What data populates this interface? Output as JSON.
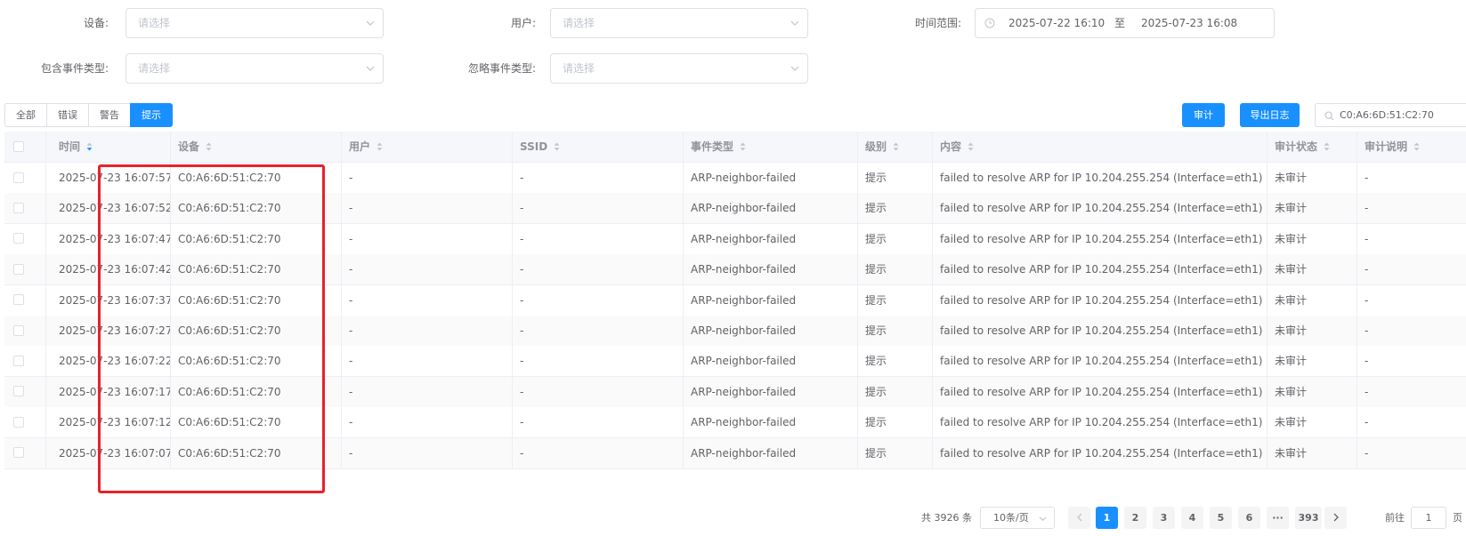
{
  "filters": {
    "device_label": "设备:",
    "device_placeholder": "请选择",
    "user_label": "用户:",
    "user_placeholder": "请选择",
    "time_label": "时间范围:",
    "time_start": "2025-07-22 16:10",
    "time_sep": "至",
    "time_end": "2025-07-23 16:08",
    "include_label": "包含事件类型:",
    "include_placeholder": "请选择",
    "ignore_label": "忽略事件类型:",
    "ignore_placeholder": "请选择"
  },
  "level_tabs": [
    {
      "label": "全部",
      "active": false
    },
    {
      "label": "错误",
      "active": false
    },
    {
      "label": "警告",
      "active": false
    },
    {
      "label": "提示",
      "active": true
    }
  ],
  "toolbar": {
    "audit_label": "审计",
    "export_label": "导出日志",
    "search_value": "C0:A6:6D:51:C2:70"
  },
  "table": {
    "columns": [
      "时间",
      "设备",
      "用户",
      "SSID",
      "事件类型",
      "级别",
      "内容",
      "审计状态",
      "审计说明"
    ],
    "rows": [
      [
        "2025-07-23 16:07:57",
        "C0:A6:6D:51:C2:70",
        "-",
        "-",
        "ARP-neighbor-failed",
        "提示",
        "failed to resolve ARP for IP 10.204.255.254 (Interface=eth1)",
        "未审计",
        "-"
      ],
      [
        "2025-07-23 16:07:52",
        "C0:A6:6D:51:C2:70",
        "-",
        "-",
        "ARP-neighbor-failed",
        "提示",
        "failed to resolve ARP for IP 10.204.255.254 (Interface=eth1)",
        "未审计",
        "-"
      ],
      [
        "2025-07-23 16:07:47",
        "C0:A6:6D:51:C2:70",
        "-",
        "-",
        "ARP-neighbor-failed",
        "提示",
        "failed to resolve ARP for IP 10.204.255.254 (Interface=eth1)",
        "未审计",
        "-"
      ],
      [
        "2025-07-23 16:07:42",
        "C0:A6:6D:51:C2:70",
        "-",
        "-",
        "ARP-neighbor-failed",
        "提示",
        "failed to resolve ARP for IP 10.204.255.254 (Interface=eth1)",
        "未审计",
        "-"
      ],
      [
        "2025-07-23 16:07:37",
        "C0:A6:6D:51:C2:70",
        "-",
        "-",
        "ARP-neighbor-failed",
        "提示",
        "failed to resolve ARP for IP 10.204.255.254 (Interface=eth1)",
        "未审计",
        "-"
      ],
      [
        "2025-07-23 16:07:27",
        "C0:A6:6D:51:C2:70",
        "-",
        "-",
        "ARP-neighbor-failed",
        "提示",
        "failed to resolve ARP for IP 10.204.255.254 (Interface=eth1)",
        "未审计",
        "-"
      ],
      [
        "2025-07-23 16:07:22",
        "C0:A6:6D:51:C2:70",
        "-",
        "-",
        "ARP-neighbor-failed",
        "提示",
        "failed to resolve ARP for IP 10.204.255.254 (Interface=eth1)",
        "未审计",
        "-"
      ],
      [
        "2025-07-23 16:07:17",
        "C0:A6:6D:51:C2:70",
        "-",
        "-",
        "ARP-neighbor-failed",
        "提示",
        "failed to resolve ARP for IP 10.204.255.254 (Interface=eth1)",
        "未审计",
        "-"
      ],
      [
        "2025-07-23 16:07:12",
        "C0:A6:6D:51:C2:70",
        "-",
        "-",
        "ARP-neighbor-failed",
        "提示",
        "failed to resolve ARP for IP 10.204.255.254 (Interface=eth1)",
        "未审计",
        "-"
      ],
      [
        "2025-07-23 16:07:07",
        "C0:A6:6D:51:C2:70",
        "-",
        "-",
        "ARP-neighbor-failed",
        "提示",
        "failed to resolve ARP for IP 10.204.255.254 (Interface=eth1)",
        "未审计",
        "-"
      ]
    ]
  },
  "pagination": {
    "total_text": "共 3926 条",
    "page_size": "10条/页",
    "pages": [
      "1",
      "2",
      "3",
      "4",
      "5",
      "6",
      "···",
      "393"
    ],
    "current_page": "1",
    "goto_label": "前往",
    "goto_value": "1",
    "goto_suffix": "页"
  },
  "colors": {
    "primary": "#1890ff",
    "highlight": "#e8212b",
    "border": "#dcdfe6"
  }
}
